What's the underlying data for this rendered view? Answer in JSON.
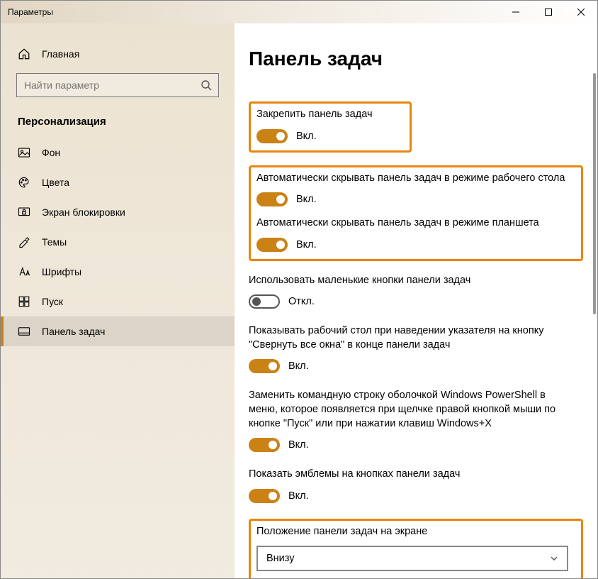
{
  "window": {
    "title": "Параметры"
  },
  "sidebar": {
    "home": "Главная",
    "search_placeholder": "Найти параметр",
    "category": "Персонализация",
    "items": [
      {
        "label": "Фон"
      },
      {
        "label": "Цвета"
      },
      {
        "label": "Экран блокировки"
      },
      {
        "label": "Темы"
      },
      {
        "label": "Шрифты"
      },
      {
        "label": "Пуск"
      },
      {
        "label": "Панель задач"
      }
    ]
  },
  "content": {
    "title": "Панель задач",
    "states": {
      "on": "Вкл.",
      "off": "Откл."
    },
    "settings": {
      "lock": {
        "label": "Закрепить панель задач",
        "on": true
      },
      "autohide_desktop": {
        "label": "Автоматически скрывать панель задач в режиме рабочего стола",
        "on": true
      },
      "autohide_tablet": {
        "label": "Автоматически скрывать панель задач в режиме планшета",
        "on": true
      },
      "small_buttons": {
        "label": "Использовать маленькие кнопки панели задач",
        "on": false
      },
      "peek": {
        "label": "Показывать рабочий стол при наведении указателя на кнопку \"Свернуть все окна\" в конце панели задач",
        "on": true
      },
      "powershell": {
        "label": "Заменить командную строку оболочкой Windows PowerShell в меню, которое появляется при щелчке правой кнопкой мыши по кнопке \"Пуск\" или при нажатии клавиш Windows+X",
        "on": true
      },
      "badges": {
        "label": "Показать эмблемы на кнопках панели задач",
        "on": true
      },
      "position": {
        "label": "Положение панели задач на экране",
        "value": "Внизу"
      }
    }
  }
}
